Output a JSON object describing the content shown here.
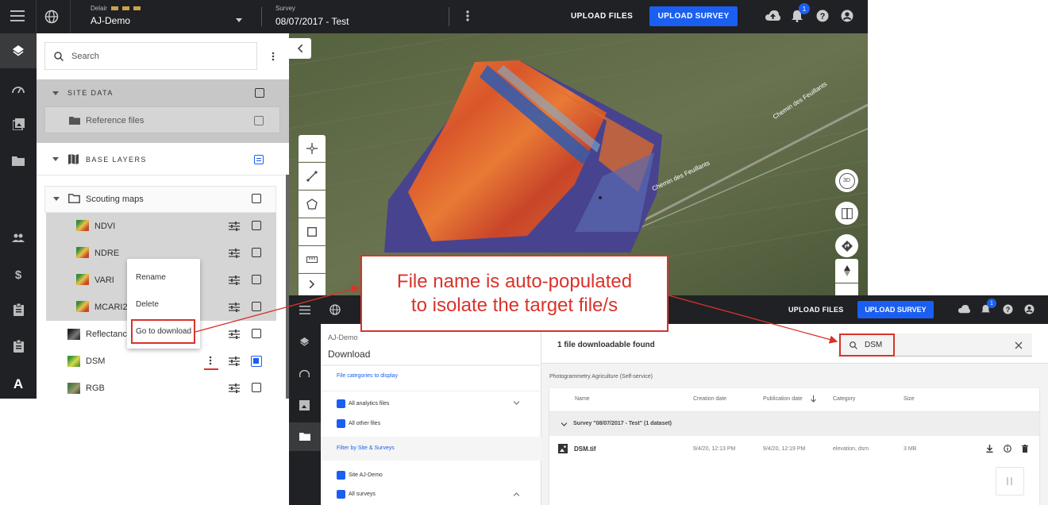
{
  "topbar": {
    "org_label": "Delair",
    "project": "AJ-Demo",
    "survey_label": "Survey",
    "survey_value": "08/07/2017 - Test",
    "upload_files": "UPLOAD FILES",
    "upload_survey": "UPLOAD SURVEY",
    "notification_count": "1"
  },
  "panel": {
    "search_placeholder": "Search",
    "site_data": "SITE DATA",
    "reference_files": "Reference files",
    "base_layers": "BASE LAYERS",
    "scouting_maps": "Scouting maps",
    "layers": [
      "NDVI",
      "NDRE",
      "VARI",
      "MCARI2",
      "Reflectance",
      "DSM",
      "RGB"
    ]
  },
  "context_menu": {
    "rename": "Rename",
    "delete": "Delete",
    "go_to_download": "Go to download"
  },
  "map": {
    "road_label_1": "Chemin des Feuillants",
    "road_label_2": "Chemin des Feuillants",
    "btn_3d": "3D"
  },
  "callout": {
    "line1": "File name is auto-populated",
    "line2": "to isolate the target file/s"
  },
  "download": {
    "upload_files": "UPLOAD FILES",
    "upload_survey": "UPLOAD SURVEY",
    "notification_count": "1",
    "project": "AJ-Demo",
    "title": "Download",
    "file_categories": "File categories to display",
    "all_analytics": "All analytics files",
    "all_other": "All other files",
    "filter_site": "Filter by Site & Surveys",
    "site": "Site AJ-Demo",
    "all_surveys": "All surveys",
    "found": "1 file downloadable found",
    "search_value": "DSM",
    "section": "Photogrammetry Agriculture (Self-service)",
    "columns": [
      "Name",
      "Creation date",
      "Publication date",
      "Category",
      "Size"
    ],
    "group": "Survey \"08/07/2017 - Test\" (1 dataset)",
    "row": {
      "name": "DSM.tif",
      "creation": "9/4/20, 12:13 PM",
      "publication": "9/4/20, 12:19 PM",
      "category": "elevation, dsm",
      "size": "3 MB"
    }
  },
  "colors": {
    "dark": "#202124",
    "accent": "#1a5ff2",
    "callout_red": "#d9332b"
  }
}
